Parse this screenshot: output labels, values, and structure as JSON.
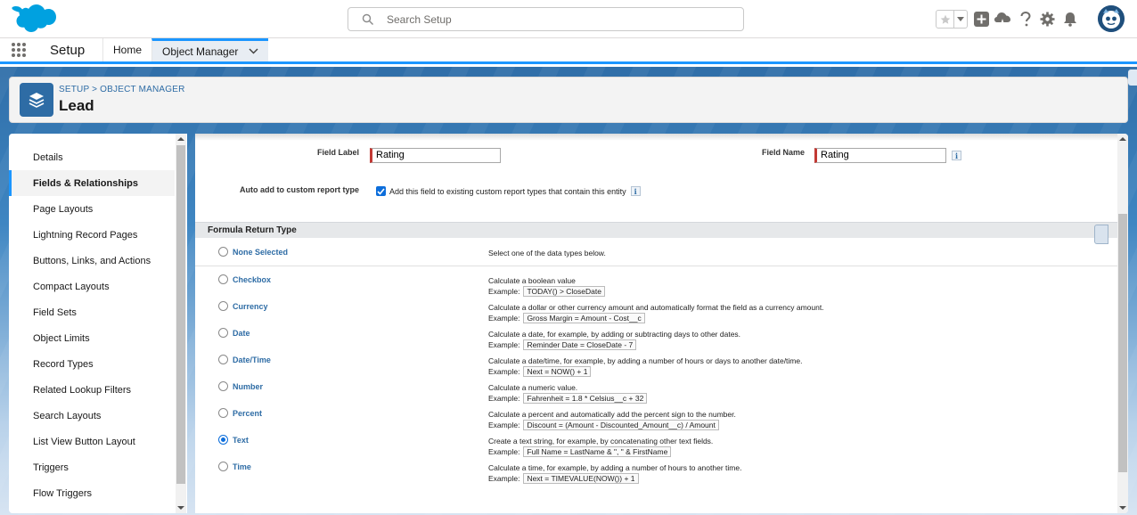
{
  "header": {
    "search_placeholder": "Search Setup"
  },
  "context_bar": {
    "app_name": "Setup",
    "tabs": [
      {
        "label": "Home"
      },
      {
        "label": "Object Manager"
      }
    ]
  },
  "page_header": {
    "breadcrumb": "SETUP > OBJECT MANAGER",
    "title": "Lead"
  },
  "sidebar": {
    "items": [
      "Details",
      "Fields & Relationships",
      "Page Layouts",
      "Lightning Record Pages",
      "Buttons, Links, and Actions",
      "Compact Layouts",
      "Field Sets",
      "Object Limits",
      "Record Types",
      "Related Lookup Filters",
      "Search Layouts",
      "List View Button Layout",
      "Triggers",
      "Flow Triggers"
    ],
    "active_index": 1
  },
  "form": {
    "field_label_label": "Field Label",
    "field_label_value": "Rating",
    "field_name_label": "Field Name",
    "field_name_value": "Rating",
    "auto_add_label": "Auto add to custom report type",
    "auto_add_text": "Add this field to existing custom report types that contain this entity",
    "auto_add_checked": true,
    "info_glyph": "i"
  },
  "formula_section": {
    "title": "Formula Return Type",
    "example_label": "Example:",
    "types": [
      {
        "name": "None Selected",
        "desc": "Select one of the data types below.",
        "example": ""
      },
      {
        "name": "Checkbox",
        "desc": "Calculate a boolean value",
        "example": "TODAY() > CloseDate"
      },
      {
        "name": "Currency",
        "desc": "Calculate a dollar or other currency amount and automatically format the field as a currency amount.",
        "example": "Gross Margin = Amount - Cost__c"
      },
      {
        "name": "Date",
        "desc": "Calculate a date, for example, by adding or subtracting days to other dates.",
        "example": "Reminder Date = CloseDate - 7"
      },
      {
        "name": "Date/Time",
        "desc": "Calculate a date/time, for example, by adding a number of hours or days to another date/time.",
        "example": "Next = NOW() + 1"
      },
      {
        "name": "Number",
        "desc": "Calculate a numeric value.",
        "example": "Fahrenheit = 1.8 * Celsius__c + 32"
      },
      {
        "name": "Percent",
        "desc": "Calculate a percent and automatically add the percent sign to the number.",
        "example": "Discount = (Amount - Discounted_Amount__c) / Amount"
      },
      {
        "name": "Text",
        "desc": "Create a text string, for example, by concatenating other text fields.",
        "example": "Full Name = LastName & \", \" & FirstName"
      },
      {
        "name": "Time",
        "desc": "Calculate a time, for example, by adding a number of hours to another time.",
        "example": "Next = TIMEVALUE(NOW()) + 1"
      }
    ],
    "selected": "Text"
  },
  "colors": {
    "brand_blue": "#1b96ff",
    "link_blue": "#2e6ca5",
    "required_red": "#c23934"
  }
}
